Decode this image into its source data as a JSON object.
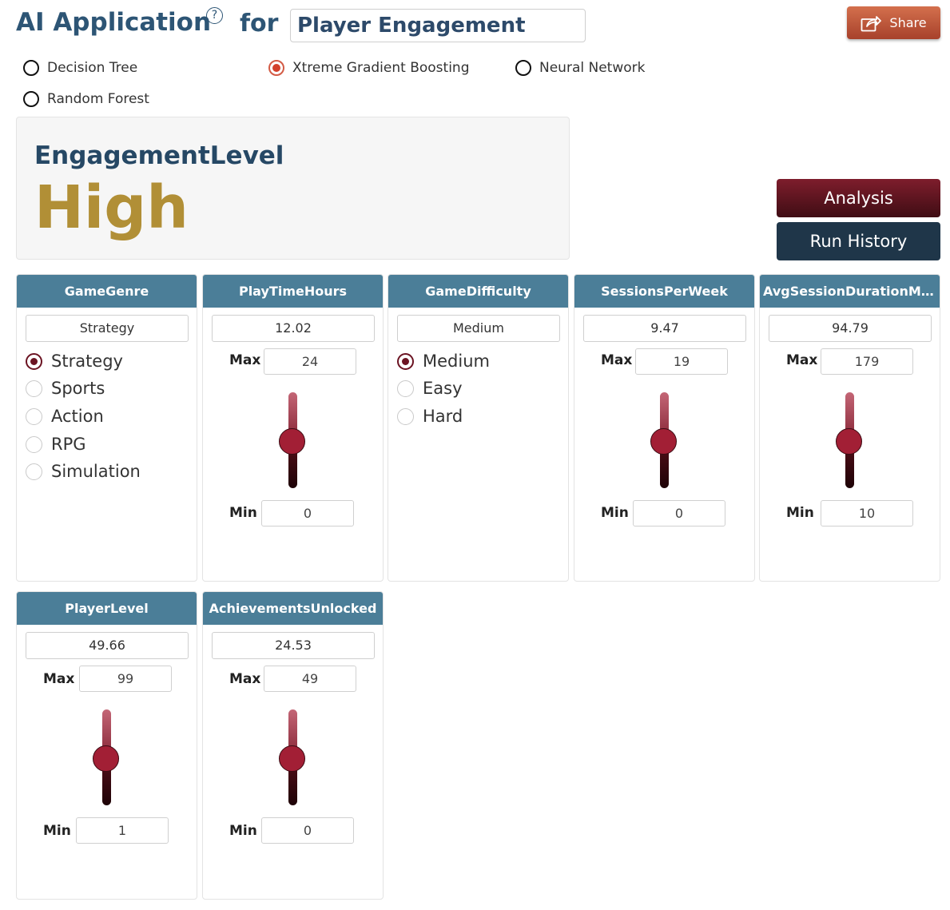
{
  "header": {
    "title": "AI Application",
    "help_icon": "?",
    "for_label": "for",
    "app_name": "Player Engagement",
    "share_label": "Share",
    "share_icon": "share-icon"
  },
  "models": [
    {
      "label": "Decision Tree",
      "selected": false
    },
    {
      "label": "Xtreme Gradient Boosting",
      "selected": true
    },
    {
      "label": "Neural Network",
      "selected": false
    },
    {
      "label": "Random Forest",
      "selected": false
    }
  ],
  "result": {
    "label": "EngagementLevel",
    "value": "High",
    "value_color": "#b18f36"
  },
  "actions": {
    "analysis_label": "Analysis",
    "history_label": "Run History"
  },
  "features": [
    {
      "name": "GameGenre",
      "value": "Strategy",
      "options": [
        "Strategy",
        "Sports",
        "Action",
        "RPG",
        "Simulation"
      ],
      "selected": "Strategy"
    },
    {
      "name": "PlayTimeHours",
      "value": "12.02",
      "max_label": "Max",
      "max": "24",
      "min_label": "Min",
      "min": "0"
    },
    {
      "name": "GameDifficulty",
      "value": "Medium",
      "options": [
        "Medium",
        "Easy",
        "Hard"
      ],
      "selected": "Medium"
    },
    {
      "name": "SessionsPerWeek",
      "value": "9.47",
      "max_label": "Max",
      "max": "19",
      "min_label": "Min",
      "min": "0"
    },
    {
      "name": "AvgSessionDurationMi...",
      "value": "94.79",
      "max_label": "Max",
      "max": "179",
      "min_label": "Min",
      "min": "10"
    },
    {
      "name": "PlayerLevel",
      "value": "49.66",
      "max_label": "Max",
      "max": "99",
      "min_label": "Min",
      "min": "1"
    },
    {
      "name": "AchievementsUnlocked",
      "value": "24.53",
      "max_label": "Max",
      "max": "49",
      "min_label": "Min",
      "min": "0"
    }
  ],
  "colors": {
    "title": "#2d5575",
    "card_header": "#4b7e98",
    "share": "#c25a3d",
    "analysis": "#6a1724",
    "history": "#1f3649"
  }
}
